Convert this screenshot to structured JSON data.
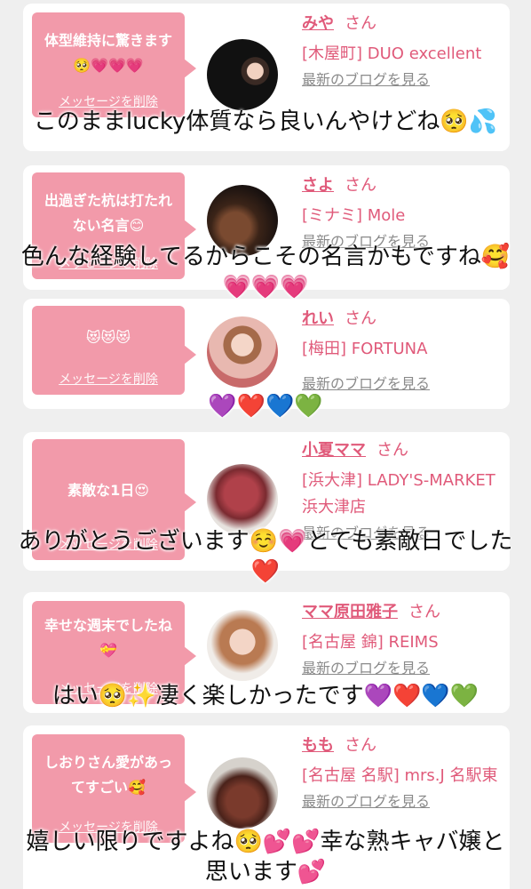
{
  "colors": {
    "bubble": "#f29aaa",
    "name": "#e05a7a",
    "link_gray": "#8a8a8a",
    "background": "#efefef"
  },
  "messages": [
    {
      "bubble_text": "体型維持に驚きます🥺💗💗💗",
      "delete_label": "メッセージを削除",
      "host_name": "みや",
      "honorific": "さん",
      "shop": "[木屋町] DUO excellent",
      "blog_link": "最新のブログを見る",
      "overlay_caption": "このままlucky体質なら良いんやけどね🥺💦"
    },
    {
      "bubble_text": "出過ぎた杭は打たれない名言😊",
      "delete_label": "メッセージを削除",
      "host_name": "さよ",
      "honorific": "さん",
      "shop": "[ミナミ] Mole",
      "blog_link": "最新のブログを見る",
      "overlay_caption": "色んな経験してるからこその名言かもですね🥰💗💗💗"
    },
    {
      "bubble_text": "😻😻😻",
      "delete_label": "メッセージを削除",
      "host_name": "れい",
      "honorific": "さん",
      "shop": "[梅田] FORTUNA",
      "blog_link": "最新のブログを見る",
      "overlay_caption": "💜❤️💙💚"
    },
    {
      "bubble_text": "素敵な1日😍",
      "delete_label": "メッセージを削除",
      "host_name": "小夏ママ",
      "honorific": "さん",
      "shop": "[浜大津] LADY'S-MARKET 浜大津店",
      "blog_link": "最新のブログを見る",
      "overlay_caption": "ありがとうございます☺️💗とても素敵日でした❤️"
    },
    {
      "bubble_text": "幸せな週末でしたね💝",
      "delete_label": "メッセージを削除",
      "host_name": "ママ原田雅子",
      "honorific": "さん",
      "shop": "[名古屋 錦] REIMS",
      "blog_link": "最新のブログを見る",
      "overlay_caption": "はい🥺✨凄く楽しかったです💜❤️💙💚"
    },
    {
      "bubble_text": "しおりさん愛があってすごい🥰",
      "delete_label": "メッセージを削除",
      "host_name": "もも",
      "honorific": "さん",
      "shop": "[名古屋 名駅] mrs.J 名駅東",
      "blog_link": "最新のブログを見る",
      "overlay_caption": "嬉しい限りですよね🥺💕💕幸な熟キャバ嬢と思います💕"
    }
  ]
}
